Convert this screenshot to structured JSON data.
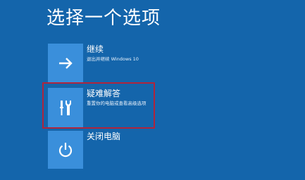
{
  "title": "选择一个选项",
  "options": [
    {
      "label": "继续",
      "description": "退出并继续 Windows 10",
      "icon": "arrow-right-icon"
    },
    {
      "label": "疑难解答",
      "description": "重置你的电脑或查看高级选项",
      "icon": "tools-icon"
    },
    {
      "label": "关闭电脑",
      "description": "",
      "icon": "power-icon"
    }
  ],
  "colors": {
    "background": "#1465ab",
    "tile": "#3a8fdb",
    "highlight": "#b0243c"
  }
}
